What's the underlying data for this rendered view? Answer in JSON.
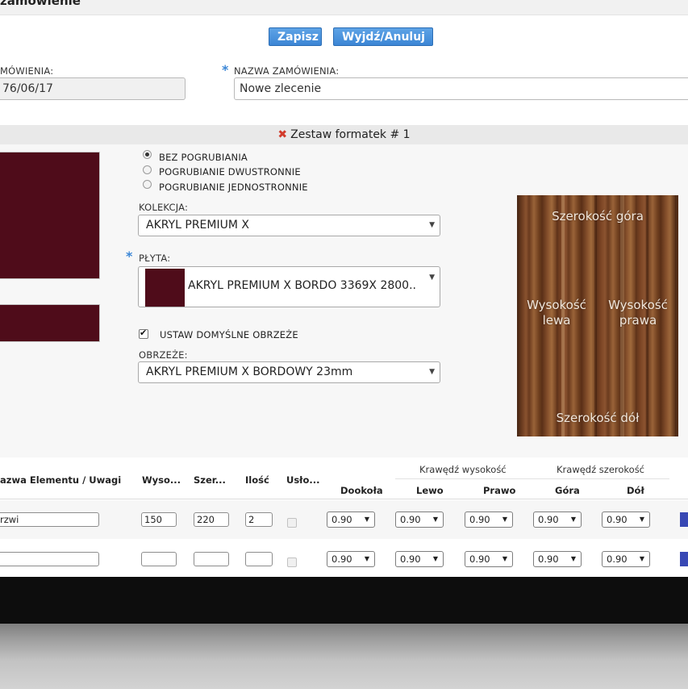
{
  "header": {
    "title": "zamówienie"
  },
  "toolbar": {
    "save_label": "Zapisz",
    "exit_label": "Wyjdź/Anuluj"
  },
  "form": {
    "date_label": "MÓWIENIA:",
    "date_value": "76/06/17",
    "required_marker": "*",
    "name_label": "NAZWA ZAMÓWIENIA:",
    "name_value": "Nowe zlecenie"
  },
  "section": {
    "title": "Zestaw formatek # 1",
    "remove_icon": "✖"
  },
  "thickening": {
    "options": [
      "BEZ POGRUBIANIA",
      "POGRUBIANIE DWUSTRONNIE",
      "POGRUBIANIE JEDNOSTRONNIE"
    ],
    "selected": "BEZ POGRUBIANIA"
  },
  "collection": {
    "label": "KOLEKCJA:",
    "value": "AKRYL PREMIUM X"
  },
  "board": {
    "label": "PŁYTA:",
    "value": "AKRYL PREMIUM X BORDO 3369X 2800..",
    "swatch_color": "#4f0c1a"
  },
  "default_edge": {
    "label": "USTAW DOMYŚLNE OBRZEŻE",
    "checked": true
  },
  "edge": {
    "label": "OBRZEŻE:",
    "value": "AKRYL PREMIUM X BORDOWY 23mm"
  },
  "preview": {
    "top": "Szerokość góra",
    "left": [
      "Wysokość",
      "lewa"
    ],
    "right": [
      "Wysokość",
      "prawa"
    ],
    "bottom": "Szerokość dół"
  },
  "table": {
    "group_height": "Krawędź wysokość",
    "group_width": "Krawędź szerokość",
    "headers": {
      "name": "azwa Elementu / Uwagi",
      "height": "Wyso...",
      "width": "Szer...",
      "qty": "Ilość",
      "service": "Usło...",
      "around": "Dookoła",
      "left": "Lewo",
      "right": "Prawo",
      "top": "Góra",
      "bottom": "Dół"
    },
    "rows": [
      {
        "name": "rzwi",
        "height": "150",
        "width": "220",
        "qty": "2",
        "around": "0.90",
        "left": "0.90",
        "right": "0.90",
        "top": "0.90",
        "bottom": "0.90"
      },
      {
        "name": "",
        "height": "",
        "width": "",
        "qty": "",
        "around": "0.90",
        "left": "0.90",
        "right": "0.90",
        "top": "0.90",
        "bottom": "0.90"
      }
    ]
  },
  "colors": {
    "accent": "#3c86d5",
    "bordo": "#4f0c1a",
    "remove": "#d23b2b"
  }
}
